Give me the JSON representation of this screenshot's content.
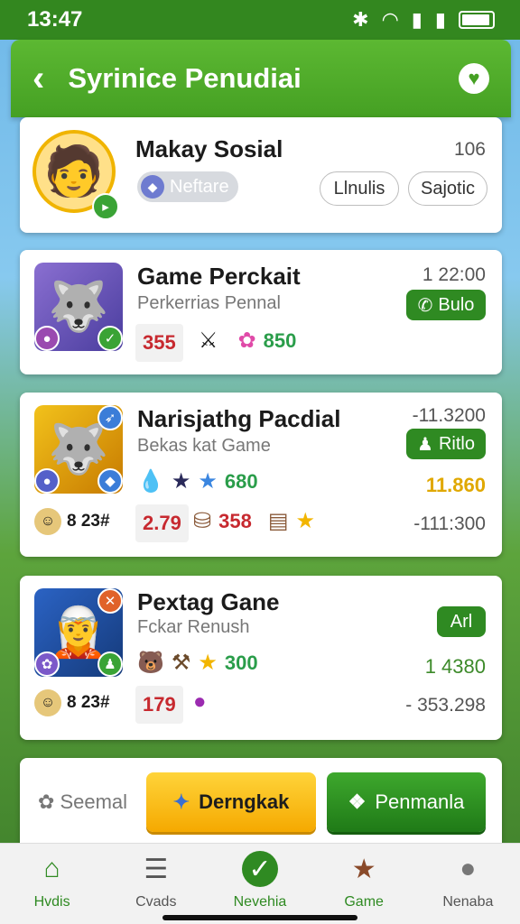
{
  "status": {
    "time": "13:47"
  },
  "header": {
    "title": "Syrinice Penudiai"
  },
  "profile_card": {
    "name": "Makay Sosial",
    "count": "106",
    "tag": "Neftare",
    "btn1": "Llnulis",
    "btn2": "Sajotic"
  },
  "games": [
    {
      "title": "Game Perckait",
      "subtitle": "Perkerrias Pennal",
      "right_top": "1 22:00",
      "button": "Bulo",
      "score": "355",
      "stat_value": "850"
    },
    {
      "title": "Narisjathg Pacdial",
      "subtitle": "Bekas kat Game",
      "right_top": "-11.3200",
      "button": "Ritlo",
      "stat_value": "680",
      "gold_value": "11.860",
      "user_score": "8 23#",
      "score": "2.79",
      "red_value": "358",
      "right_bottom": "-111:300"
    },
    {
      "title": "Pextag Gane",
      "subtitle": "Fckar Renush",
      "button": "Arl",
      "stat_value": "300",
      "green_value": "1 4380",
      "user_score": "8 23#",
      "score": "179",
      "right_bottom": "- 353.298"
    }
  ],
  "actions": {
    "label": "Seemal",
    "primary": "Derngkak",
    "secondary": "Penmanla"
  },
  "nav": [
    {
      "label": "Hvdis",
      "icon": "home-icon"
    },
    {
      "label": "Cvads",
      "icon": "list-icon"
    },
    {
      "label": "Nevehia",
      "icon": "check-icon"
    },
    {
      "label": "Game",
      "icon": "star-icon"
    },
    {
      "label": "Nenaba",
      "icon": "person-icon"
    }
  ],
  "colors": {
    "primary_green": "#45a023",
    "accent_gold": "#f5a900",
    "score_red": "#c7292f"
  }
}
